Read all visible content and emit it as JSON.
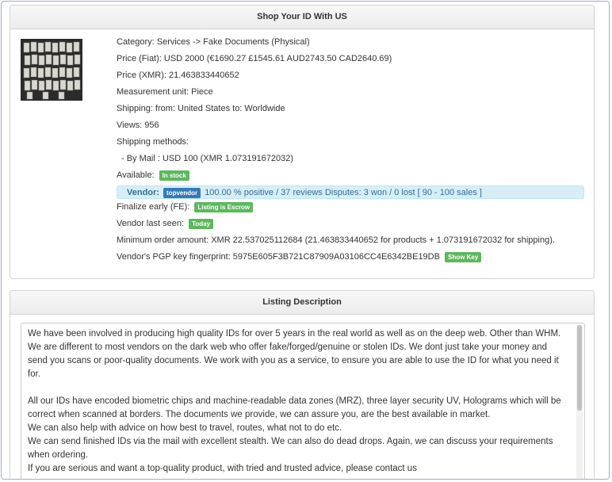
{
  "product_panel": {
    "title": "Shop Your ID With US",
    "category": "Category: Services -> Fake Documents (Physical)",
    "price_fiat": "Price (Fiat): USD 2000 (€1690.27 £1545.61 AUD2743.50 CAD2640.69)",
    "price_xmr": "Price (XMR): 21.463833440652",
    "measurement": "Measurement unit: Piece",
    "shipping": "Shipping: from: United States to: Worldwide",
    "views": "Views: 956",
    "shipping_methods_label": "Shipping methods:",
    "shipping_method_1": "- By Mail : USD 100 (XMR 1.073191672032)",
    "available_label": "Available:",
    "available_badge": "In stock",
    "vendor_label": "Vendor:",
    "vendor_badge": "topvendor",
    "vendor_stats": "100.00 % positive / 37 reviews Disputes: 3 won / 0 lost [ 90 - 100 sales ]",
    "finalize_label": "Finalize early (FE):",
    "finalize_badge": "Listing is Escrow",
    "last_seen_label": "Vendor last seen:",
    "last_seen_badge": "Today",
    "min_order": "Minimum order amount: XMR 22.537025112684 (21.463833440652 for products + 1.073191672032 for shipping).",
    "pgp_label": "Vendor's PGP key fingerprint: 5975E605F3B721C87909A03106CC4E6342BE19DB",
    "show_key_button": "Show Key"
  },
  "description_panel": {
    "title": "Listing Description",
    "lines": [
      "We have been involved in producing high quality IDs for over 5 years in the real world as well as on the deep web. Other than WHM.",
      "We are different to most vendors on the dark web who offer fake/forged/genuine or stolen IDs. We dont just take your money and",
      "send you scans or poor-quality documents. We work with you as a service, to ensure you are able to use the ID for what you need it",
      "for.",
      "",
      "All our IDs have encoded biometric chips and machine-readable data zones (MRZ), three layer security UV, Holograms which will be",
      "correct when scanned at borders. The documents we provide, we can assure you, are the best available in market.",
      "We can also help with advice on how best to travel, routes, what not to do etc.",
      "We can send finished IDs via the mail with excellent stealth. We can also do dead drops. Again, we can discuss your requirements",
      "when ordering.",
      "If you are serious and want a top-quality product, with tried and trusted advice, please contact us"
    ]
  },
  "colors": {
    "badge_green": "#5cb85c",
    "badge_blue": "#337ab7",
    "vendor_bar_bg": "#d9edf7",
    "vendor_text": "#31708f"
  }
}
